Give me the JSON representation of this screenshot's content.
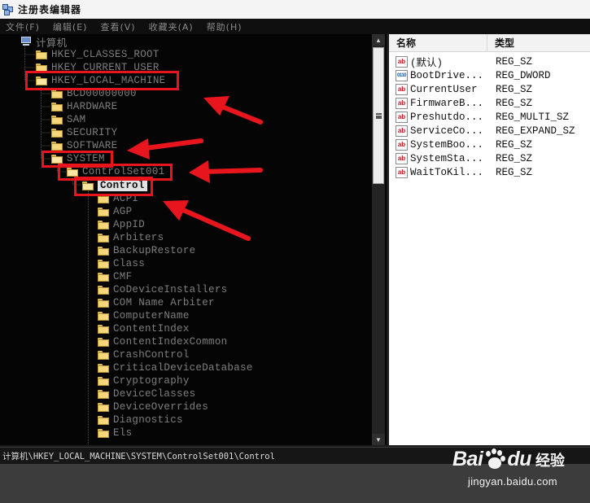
{
  "window": {
    "title": "注册表编辑器"
  },
  "menu": [
    "文件(F)",
    "编辑(E)",
    "查看(V)",
    "收藏夹(A)",
    "帮助(H)"
  ],
  "tree": {
    "root": "计算机",
    "hives_top": [
      "HKEY_CLASSES_ROOT",
      "HKEY_CURRENT_USER"
    ],
    "hklm": "HKEY_LOCAL_MACHINE",
    "hklm_children": [
      "BCD00000000",
      "HARDWARE",
      "SAM",
      "SECURITY",
      "SOFTWARE"
    ],
    "system": "SYSTEM",
    "controlset": "ControlSet001",
    "control": "Control",
    "control_children": [
      "ACPI",
      "AGP",
      "AppID",
      "Arbiters",
      "BackupRestore",
      "Class",
      "CMF",
      "CoDeviceInstallers",
      "COM Name Arbiter",
      "ComputerName",
      "ContentIndex",
      "ContentIndexCommon",
      "CrashControl",
      "CriticalDeviceDatabase",
      "Cryptography",
      "DeviceClasses",
      "DeviceOverrides",
      "Diagnostics",
      "Els"
    ]
  },
  "values": {
    "headers": {
      "name": "名称",
      "type": "类型"
    },
    "rows": [
      {
        "name": "(默认)",
        "type": "REG_SZ",
        "icon": "string-value-icon"
      },
      {
        "name": "BootDrive...",
        "type": "REG_DWORD",
        "icon": "dword-value-icon"
      },
      {
        "name": "CurrentUser",
        "type": "REG_SZ",
        "icon": "string-value-icon"
      },
      {
        "name": "FirmwareB...",
        "type": "REG_SZ",
        "icon": "string-value-icon"
      },
      {
        "name": "Preshutdo...",
        "type": "REG_MULTI_SZ",
        "icon": "string-value-icon"
      },
      {
        "name": "ServiceCo...",
        "type": "REG_EXPAND_SZ",
        "icon": "string-value-icon"
      },
      {
        "name": "SystemBoo...",
        "type": "REG_SZ",
        "icon": "string-value-icon"
      },
      {
        "name": "SystemSta...",
        "type": "REG_SZ",
        "icon": "string-value-icon"
      },
      {
        "name": "WaitToKil...",
        "type": "REG_SZ",
        "icon": "string-value-icon"
      }
    ]
  },
  "status": {
    "path": "计算机\\HKEY_LOCAL_MACHINE\\SYSTEM\\ControlSet001\\Control"
  },
  "watermark": {
    "brand_latin": "Bai",
    "brand_latin2": "du",
    "brand_cn": "经验",
    "url": "jingyan.baidu.com"
  },
  "colors": {
    "highlight": "#e8161c",
    "tree_bg": "#050505",
    "tree_text": "#7e7e7e"
  }
}
